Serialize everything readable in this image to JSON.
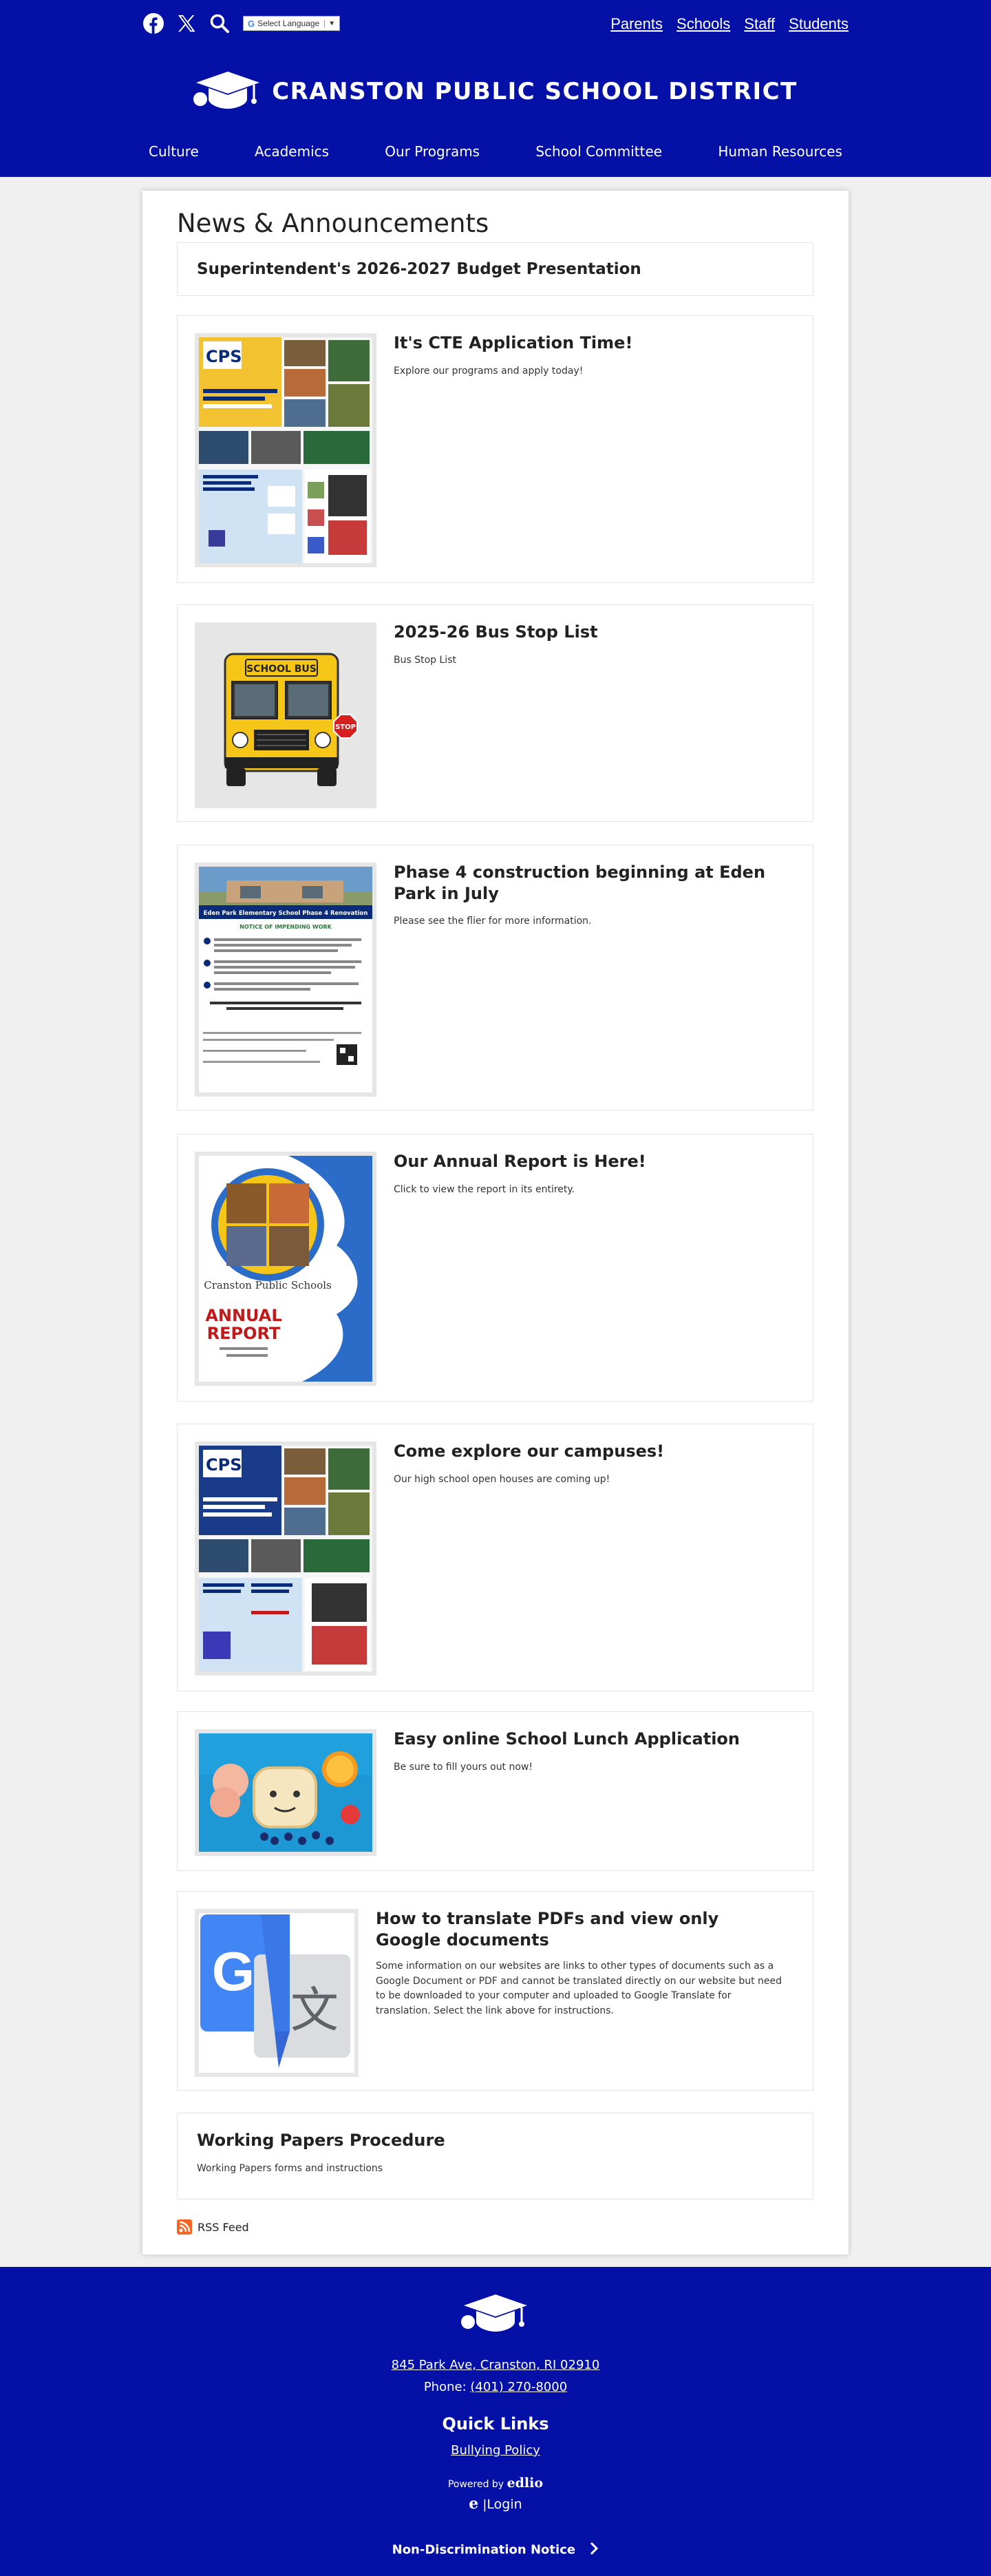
{
  "header": {
    "translate_label": "Select Language",
    "utility_links": [
      "Parents",
      "Schools",
      "Staff",
      "Students"
    ],
    "district_name": "CRANSTON PUBLIC SCHOOL DISTRICT",
    "nav": [
      "Culture",
      "Academics",
      "Our Programs",
      "School Committee",
      "Human Resources"
    ]
  },
  "main": {
    "title": "News & Announcements",
    "articles": [
      {
        "title": "Superintendent's 2026-2027 Budget Presentation",
        "desc": ""
      },
      {
        "title": "It's CTE Application Time!",
        "desc": "Explore our programs and apply today!"
      },
      {
        "title": "2025-26 Bus Stop List",
        "desc": "Bus Stop List"
      },
      {
        "title": "Phase 4 construction beginning at Eden Park in July",
        "desc": "Please see the flier for more information."
      },
      {
        "title": "Our Annual Report is Here!",
        "desc": "Click to view the report in its entirety."
      },
      {
        "title": "Come explore our campuses!",
        "desc": "Our high school open houses are coming up!"
      },
      {
        "title": "Easy online School Lunch Application",
        "desc": "Be sure to fill yours out now!"
      },
      {
        "title": "How to translate PDFs and view only Google documents",
        "desc": "Some information on our websites are links to other types of documents such as a Google Document or PDF and cannot be translated directly on our website but need to be downloaded to your computer and uploaded to Google Translate for translation. Select the link above for instructions."
      },
      {
        "title": "Working Papers Procedure",
        "desc": "Working Papers forms and instructions"
      }
    ],
    "thumb_text": {
      "cps": "CPS",
      "school_bus": "SCHOOL BUS",
      "stop": "STOP",
      "eden_title": "Eden Park Elementary School Phase 4 Renovation",
      "eden_notice": "NOTICE OF IMPENDING WORK",
      "report_school": "Cranston Public Schools",
      "annual": "ANNUAL",
      "report": "REPORT",
      "g": "G",
      "translate_char": "文"
    },
    "rss_label": "RSS Feed"
  },
  "footer": {
    "address": "845 Park Ave, Cranston, RI 02910",
    "phone_label": "Phone:",
    "phone": "(401) 270-8000",
    "quick_links_title": "Quick Links",
    "bullying_policy": "Bullying Policy",
    "powered_by": "Powered by",
    "powered_brand": "edlio",
    "login": "Login",
    "non_discrimination": "Non-Discrimination Notice"
  },
  "colors": {
    "brand_blue": "#0511a6",
    "rss_orange": "#f26522"
  },
  "icons": [
    "facebook-icon",
    "x-twitter-icon",
    "search-icon",
    "graduation-cap-logo",
    "rss-icon",
    "edlio-icon",
    "chevron-right-icon"
  ]
}
